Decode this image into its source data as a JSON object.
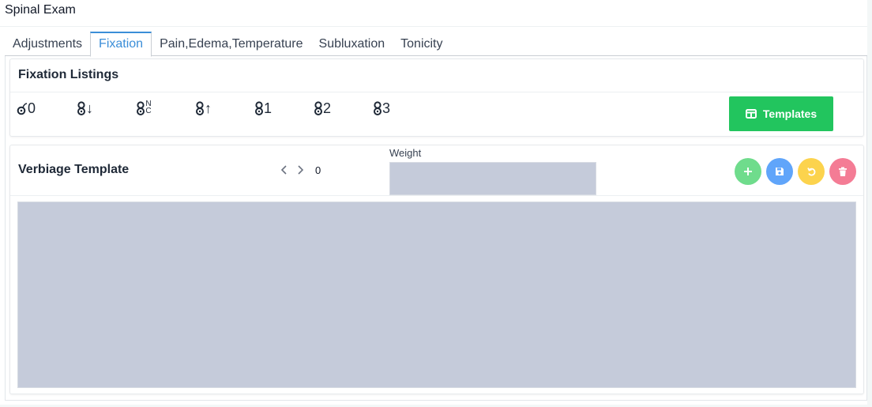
{
  "page": {
    "title": "Spinal Exam"
  },
  "tabs": [
    {
      "label": "Adjustments",
      "active": false
    },
    {
      "label": "Fixation",
      "active": true
    },
    {
      "label": "Pain,Edema,Temperature",
      "active": false
    },
    {
      "label": "Subluxation",
      "active": false
    },
    {
      "label": "Tonicity",
      "active": false
    }
  ],
  "fixation_listings": {
    "title": "Fixation Listings",
    "symbols": [
      {
        "icon": "fixation-0-icon",
        "text": "0"
      },
      {
        "icon": "fixation-down-icon",
        "text": "↓"
      },
      {
        "icon": "fixation-nc-icon",
        "text": "NC"
      },
      {
        "icon": "fixation-up-icon",
        "text": "↑"
      },
      {
        "icon": "fixation-1-icon",
        "text": "1"
      },
      {
        "icon": "fixation-2-icon",
        "text": "2"
      },
      {
        "icon": "fixation-3-icon",
        "text": "3"
      }
    ],
    "templates_button": {
      "label": "Templates",
      "icon": "table-icon",
      "color": "#22c55e"
    }
  },
  "verbiage": {
    "title": "Verbiage Template",
    "counter": "0",
    "weight_label": "Weight",
    "weight_value": "",
    "text_value": "",
    "actions": [
      {
        "name": "add",
        "icon": "plus-icon",
        "color": "#6fdc8c"
      },
      {
        "name": "save",
        "icon": "floppy-disk-icon",
        "color": "#60a5fa"
      },
      {
        "name": "reset",
        "icon": "undo-icon",
        "color": "#fcd34d"
      },
      {
        "name": "delete",
        "icon": "trash-icon",
        "color": "#f47c95"
      }
    ]
  },
  "colors": {
    "accent": "#3b8ed8",
    "input_fill": "#c5cbda"
  }
}
